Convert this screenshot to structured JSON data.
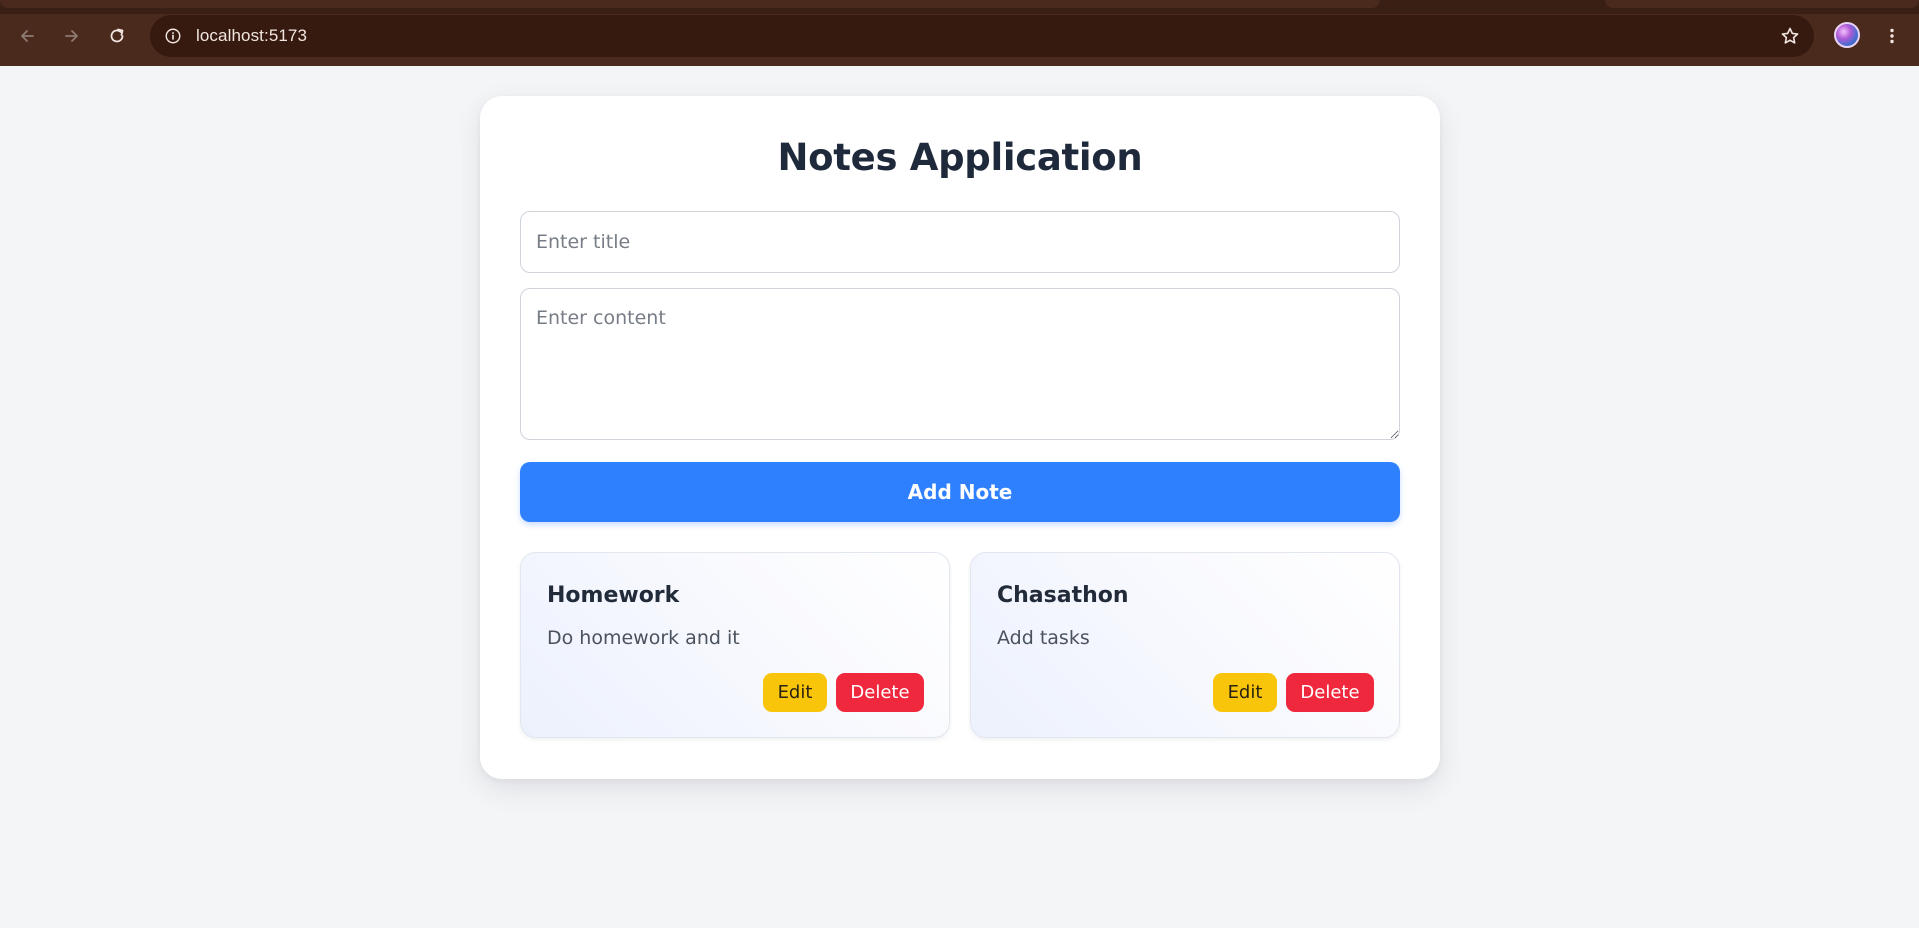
{
  "browser": {
    "url": "localhost:5173",
    "icons": {
      "back": "arrow-left-icon",
      "forward": "arrow-right-icon",
      "reload": "reload-icon",
      "site_info": "info-icon",
      "bookmark": "star-icon",
      "profile": "avatar",
      "menu": "more-vert-icon"
    }
  },
  "app": {
    "title": "Notes Application",
    "title_placeholder": "Enter title",
    "content_placeholder": "Enter content",
    "add_button_label": "Add Note"
  },
  "notes": [
    {
      "title": "Homework",
      "content": "Do homework and it",
      "edit_label": "Edit",
      "delete_label": "Delete"
    },
    {
      "title": "Chasathon",
      "content": "Add tasks",
      "edit_label": "Edit",
      "delete_label": "Delete"
    }
  ],
  "colors": {
    "chrome_bg": "#4a2a1c",
    "omnibox_bg": "#36190f",
    "primary": "#2f80fe",
    "edit": "#f8c50b",
    "delete": "#f0283d",
    "page_bg": "#f4f5f7"
  }
}
